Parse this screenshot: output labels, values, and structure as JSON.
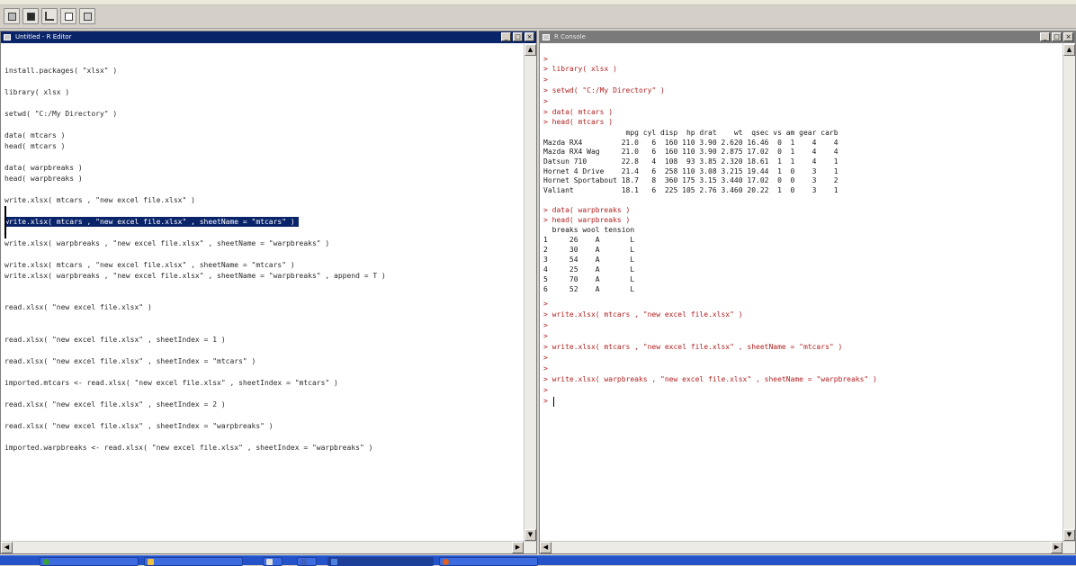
{
  "editor": {
    "title": "Untitled - R Editor",
    "lines": [
      "install.packages( \"xlsx\" )",
      "library( xlsx )",
      "setwd( \"C:/My Directory\" )",
      "data( mtcars )",
      "head( mtcars )",
      "data( warpbreaks )",
      "head( warpbreaks )",
      "write.xlsx( mtcars , \"new excel file.xlsx\" )",
      "write.xlsx( mtcars , \"new excel file.xlsx\" , sheetName = \"mtcars\" )",
      "write.xlsx( warpbreaks , \"new excel file.xlsx\" , sheetName = \"warpbreaks\" )",
      "write.xlsx( mtcars , \"new excel file.xlsx\" , sheetName = \"mtcars\" )",
      "write.xlsx( warpbreaks , \"new excel file.xlsx\" , sheetName = \"warpbreaks\" , append = T )",
      "read.xlsx( \"new excel file.xlsx\" )",
      "read.xlsx( \"new excel file.xlsx\" , sheetIndex = 1 )",
      "read.xlsx( \"new excel file.xlsx\" , sheetIndex = \"mtcars\" )",
      "imported.mtcars <- read.xlsx( \"new excel file.xlsx\" , sheetIndex = \"mtcars\" )",
      "read.xlsx( \"new excel file.xlsx\" , sheetIndex = 2 )",
      "read.xlsx( \"new excel file.xlsx\" , sheetIndex = \"warpbreaks\" )",
      "imported.warpbreaks <- read.xlsx( \"new excel file.xlsx\" , sheetIndex = \"warpbreaks\" )"
    ]
  },
  "console": {
    "title": "R Console",
    "lines": [
      ">",
      "> library( xlsx )",
      ">",
      "> setwd( \"C:/My Directory\" )",
      ">",
      "> data( mtcars )",
      "> head( mtcars )",
      "                   mpg cyl disp  hp drat    wt  qsec vs am gear carb",
      "Mazda RX4         21.0   6  160 110 3.90 2.620 16.46  0  1    4    4",
      "Mazda RX4 Wag     21.0   6  160 110 3.90 2.875 17.02  0  1    4    4",
      "Datsun 710        22.8   4  108  93 3.85 2.320 18.61  1  1    4    1",
      "Hornet 4 Drive    21.4   6  258 110 3.08 3.215 19.44  1  0    3    1",
      "Hornet Sportabout 18.7   8  360 175 3.15 3.440 17.02  0  0    3    2",
      "Valiant           18.1   6  225 105 2.76 3.460 20.22  1  0    3    1",
      "> data( warpbreaks )",
      "> head( warpbreaks )",
      "  breaks wool tension",
      "1     26    A       L",
      "2     30    A       L",
      "3     54    A       L",
      "4     25    A       L",
      "5     70    A       L",
      "6     52    A       L",
      ">",
      "> write.xlsx( mtcars , \"new excel file.xlsx\" )",
      ">",
      ">",
      "> write.xlsx( mtcars , \"new excel file.xlsx\" , sheetName = \"mtcars\" )",
      ">",
      ">",
      "> write.xlsx( warpbreaks , \"new excel file.xlsx\" , sheetName = \"warpbreaks\" )",
      ">",
      ">"
    ]
  }
}
